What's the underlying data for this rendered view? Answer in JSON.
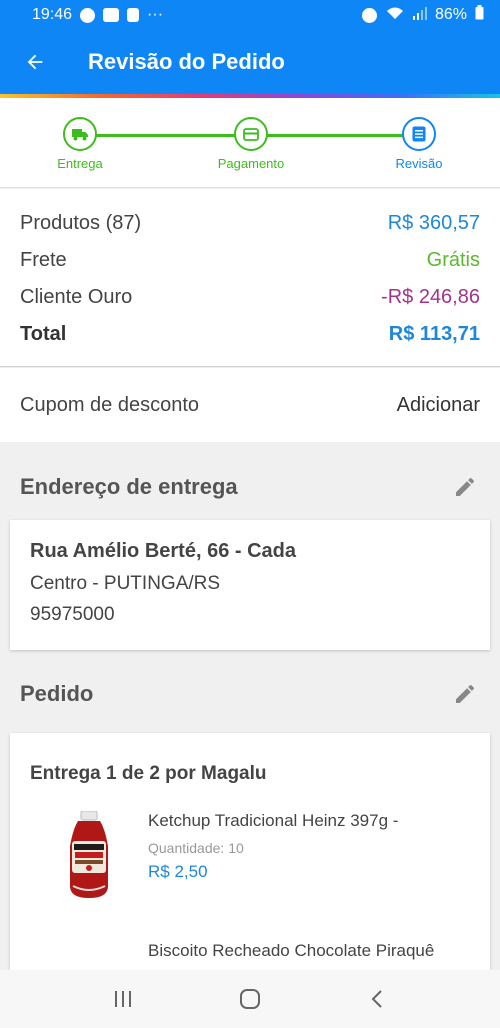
{
  "status_bar": {
    "time": "19:46",
    "battery": "86%"
  },
  "app_bar": {
    "title": "Revisão do Pedido"
  },
  "stepper": {
    "steps": [
      {
        "label": "Entrega",
        "icon": "truck-icon"
      },
      {
        "label": "Pagamento",
        "icon": "card-icon"
      },
      {
        "label": "Revisão",
        "icon": "list-icon"
      }
    ]
  },
  "summary": {
    "products_label": "Produtos (87)",
    "products_value": "R$ 360,57",
    "shipping_label": "Frete",
    "shipping_value": "Grátis",
    "gold_label": "Cliente Ouro",
    "gold_value": "-R$ 246,86",
    "total_label": "Total",
    "total_value": "R$ 113,71"
  },
  "coupon": {
    "label": "Cupom de desconto",
    "action": "Adicionar"
  },
  "address": {
    "title": "Endereço de entrega",
    "street": "Rua Amélio Berté, 66 - Cada",
    "city": "Centro - PUTINGA/RS",
    "zip": "95975000"
  },
  "order": {
    "title": "Pedido",
    "delivery": "Entrega 1 de 2 por Magalu",
    "products": [
      {
        "name": "Ketchup Tradicional Heinz 397g -",
        "qty_label": "Quantidade:",
        "qty": "10",
        "price": "R$ 2,50"
      },
      {
        "name": "Biscoito Recheado Chocolate Piraquê"
      }
    ]
  },
  "colors": {
    "primary": "#0f86f5",
    "success": "#3dbd1c",
    "discount": "#a1348b",
    "price": "#1e87d9"
  }
}
